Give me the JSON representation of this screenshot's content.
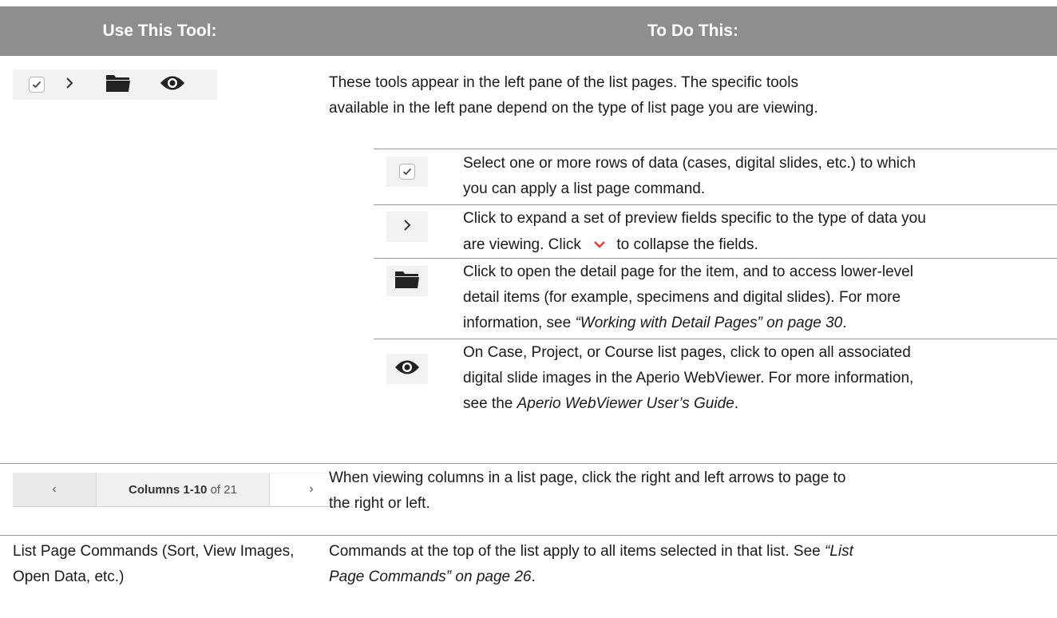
{
  "header": {
    "col1": "Use This Tool:",
    "col2": "To Do This:"
  },
  "intro": {
    "line1": "These tools appear in the left pane of the list pages. The specific tools",
    "line2": "available in the left pane depend on the type of list page you are viewing."
  },
  "icons": {
    "checkbox": "checkbox-icon",
    "expand": "chevron-right-icon",
    "collapse": "chevron-down-icon",
    "folder": "folder-icon",
    "eye": "eye-icon",
    "collapse_color": "#e8413c"
  },
  "subrows": {
    "select": {
      "line1": "Select one or more rows of data (cases, digital slides, etc.) to which",
      "line2": "you can apply a list page command."
    },
    "expand": {
      "line1": "Click to expand a set of preview fields specific to the type of data you",
      "line2_pre": "are viewing. Click",
      "line2_post": "to collapse the fields."
    },
    "detail": {
      "line1": "Click to open the detail page for the item, and to access lower-level",
      "line2": "detail items (for example, specimens and digital slides). For more",
      "line3_pre": "information, see ",
      "line3_link": "“Working with Detail Pages” on page 30",
      "line3_post": "."
    },
    "viewer": {
      "line1": "On Case, Project, or Course list pages, click to open all associated",
      "line2": "digital slide images in the Aperio WebViewer. For more information,",
      "line3_pre": "see the ",
      "line3_link": "Aperio WebViewer User’s Guide",
      "line3_post": "."
    }
  },
  "pager": {
    "prev": "‹",
    "next": "›",
    "label_bold": "Columns 1-10",
    "label_rest": " of 21"
  },
  "pager_desc": {
    "line1": "When viewing columns in a list page, click the right and left arrows to page to",
    "line2": "the right or left."
  },
  "commands": {
    "tool_line1": "List Page Commands (Sort, View Images,",
    "tool_line2": "Open Data, etc.)",
    "desc_line1_pre": "Commands at the top of the list apply to all items selected in that list. See ",
    "desc_line1_link": "“List",
    "desc_line2_link": "Page Commands” on page 26",
    "desc_line2_post": "."
  }
}
